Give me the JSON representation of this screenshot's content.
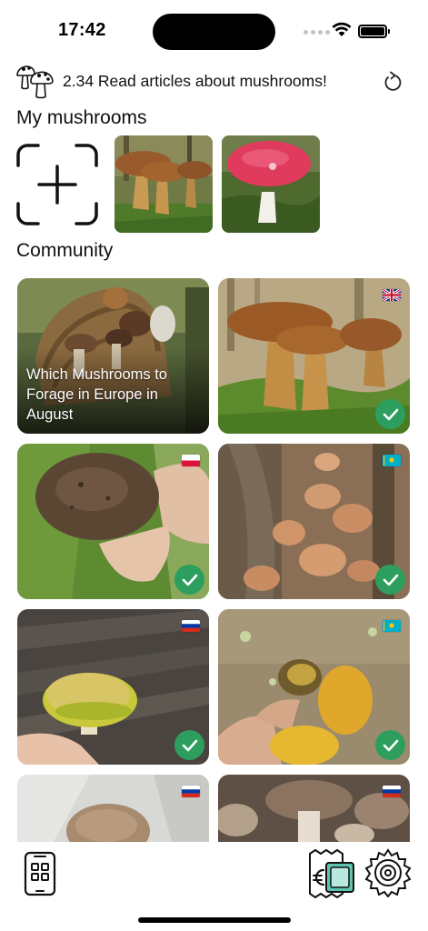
{
  "status_bar": {
    "time": "17:42"
  },
  "header": {
    "title": "2.34 Read articles about mushrooms!"
  },
  "sections": {
    "my_mushrooms": "My mushrooms",
    "community": "Community"
  },
  "community": {
    "cards": [
      {
        "caption": "Which Mushrooms to Forage in Europe in August",
        "flag": "",
        "verified": false
      },
      {
        "caption": "",
        "flag": "uk-flag",
        "verified": true
      },
      {
        "caption": "",
        "flag": "poland-flag",
        "verified": true
      },
      {
        "caption": "",
        "flag": "kazakhstan-flag",
        "verified": true
      },
      {
        "caption": "",
        "flag": "russia-flag",
        "verified": true
      },
      {
        "caption": "",
        "flag": "kazakhstan-flag",
        "verified": true
      },
      {
        "caption": "",
        "flag": "russia-flag",
        "verified": false
      },
      {
        "caption": "",
        "flag": "russia-flag",
        "verified": false
      }
    ]
  },
  "bottom_nav": {
    "left_icon": "phone-grid-icon",
    "wallet_icon": "euro-wallet-icon",
    "settings_icon": "gear-icon"
  },
  "colors": {
    "accent_green": "#2e9e5e",
    "text": "#111111"
  }
}
